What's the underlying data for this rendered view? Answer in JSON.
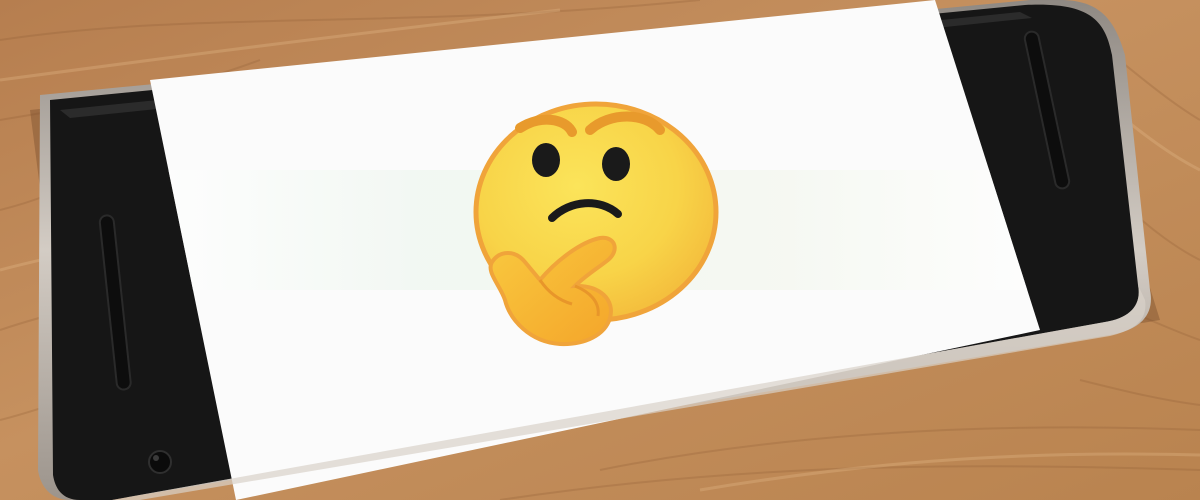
{
  "scene": {
    "subject": "smartphone-on-wooden-table",
    "screen_content": "thinking-face-emoji",
    "icons": [
      "thinking-face-emoji",
      "front-camera",
      "earpiece-speaker",
      "sensor"
    ]
  },
  "colors": {
    "wood_base": "#c08a5a",
    "wood_dark": "#8a5a34",
    "wood_light": "#d8a878",
    "phone_body": "#171717",
    "phone_frame": "#b9b2aa",
    "screen": "#fbfbfb",
    "emoji_yellow": "#f8d84a",
    "emoji_orange": "#f6a623",
    "emoji_outline": "#f0a43a",
    "emoji_features": "#1a1a1a"
  }
}
